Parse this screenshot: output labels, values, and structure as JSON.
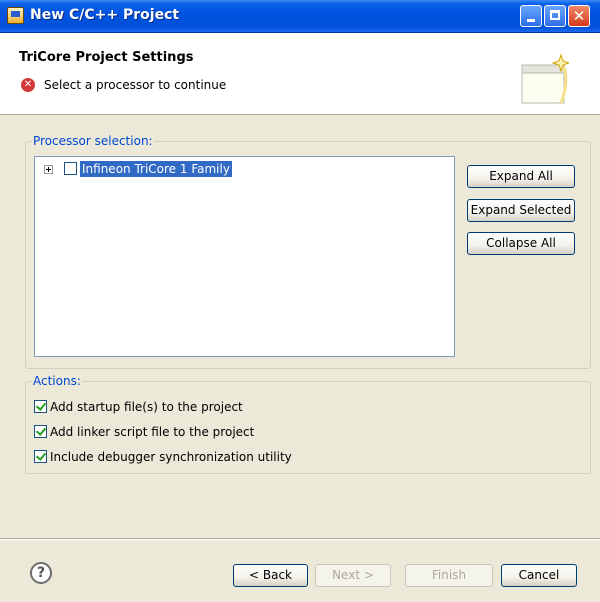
{
  "window": {
    "title": "New C/C++ Project"
  },
  "header": {
    "title": "TriCore Project Settings",
    "message": "Select a processor to continue"
  },
  "processor_selection": {
    "legend": "Processor selection:",
    "tree_items": [
      {
        "label": "Infineon TriCore 1 Family",
        "checked": false,
        "expanded": false,
        "selected": true
      }
    ],
    "buttons": {
      "expand_all": "Expand All",
      "expand_selected": "Expand Selected",
      "collapse_all": "Collapse All"
    }
  },
  "actions": {
    "legend": "Actions:",
    "options": [
      {
        "label": "Add startup file(s) to the project",
        "checked": true
      },
      {
        "label": "Add linker script file to the project",
        "checked": true
      },
      {
        "label": "Include debugger synchronization utility",
        "checked": true
      }
    ]
  },
  "footer": {
    "back": "< Back",
    "next": "Next >",
    "finish": "Finish",
    "cancel": "Cancel"
  },
  "icons": {
    "app": "eclipse-window-icon",
    "error": "error-icon",
    "help": "help-icon",
    "wizard": "wizard-banner-icon"
  }
}
